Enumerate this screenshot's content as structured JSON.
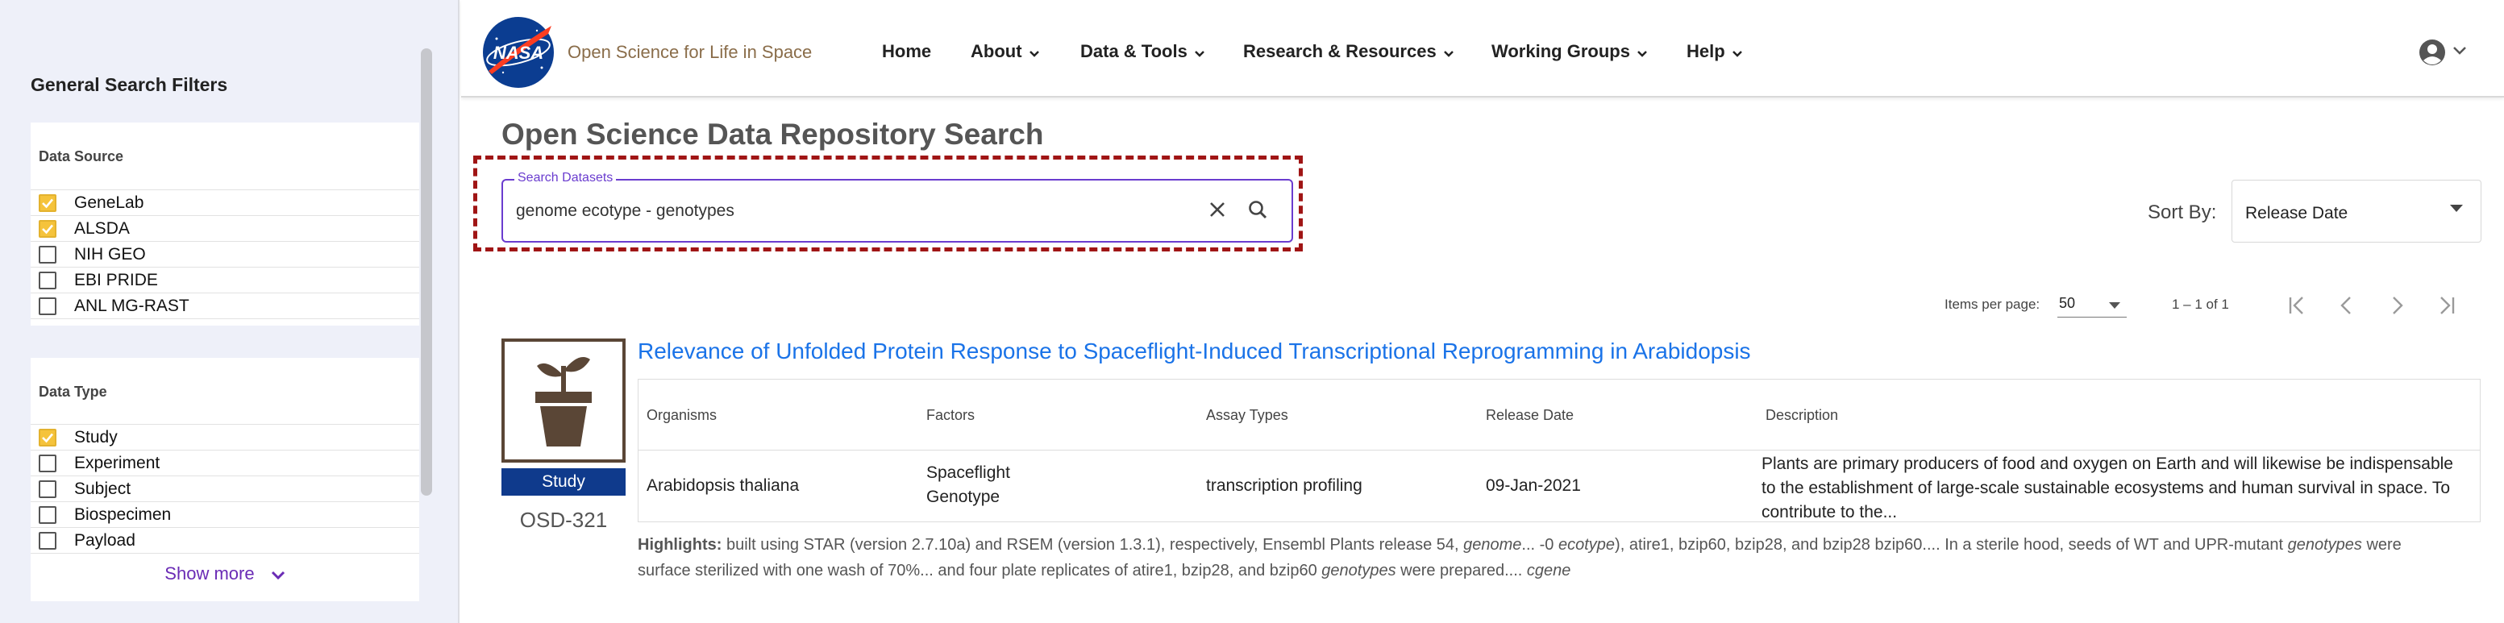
{
  "sidebar": {
    "title": "General Search Filters",
    "data_source": {
      "title": "Data Source",
      "items": [
        {
          "label": "GeneLab",
          "checked": true
        },
        {
          "label": "ALSDA",
          "checked": true
        },
        {
          "label": "NIH GEO",
          "checked": false
        },
        {
          "label": "EBI PRIDE",
          "checked": false
        },
        {
          "label": "ANL MG-RAST",
          "checked": false
        }
      ]
    },
    "data_type": {
      "title": "Data Type",
      "items": [
        {
          "label": "Study",
          "checked": true
        },
        {
          "label": "Experiment",
          "checked": false
        },
        {
          "label": "Subject",
          "checked": false
        },
        {
          "label": "Biospecimen",
          "checked": false
        },
        {
          "label": "Payload",
          "checked": false
        }
      ],
      "show_more": "Show more"
    }
  },
  "header": {
    "logo_text": "NASA",
    "site_name": "Open Science for Life in Space",
    "nav": [
      "Home",
      "About",
      "Data & Tools",
      "Research & Resources",
      "Working Groups",
      "Help"
    ]
  },
  "main": {
    "title": "Open Science Data Repository Search",
    "search": {
      "label": "Search Datasets",
      "value": "genome ecotype - genotypes"
    },
    "sort": {
      "label": "Sort By:",
      "value": "Release Date"
    },
    "pagination": {
      "items_per_page_label": "Items per page:",
      "items_per_page": "50",
      "range": "1 – 1 of 1"
    }
  },
  "result": {
    "badge": "Study",
    "id": "OSD-321",
    "title": "Relevance of Unfolded Protein Response to Spaceflight-Induced Transcriptional Reprogramming in Arabidopsis",
    "headers": [
      "Organisms",
      "Factors",
      "Assay Types",
      "Release Date",
      "Description"
    ],
    "organism": "Arabidopsis thaliana",
    "factors": [
      "Spaceflight",
      "Genotype"
    ],
    "assay": "transcription profiling",
    "release_date": "09-Jan-2021",
    "description": "Plants are primary producers of food and oxygen on Earth and will likewise be indispensable to the establishment of large-scale sustainable ecosystems and human survival in space. To contribute to the...",
    "highlights_label": "Highlights:",
    "highlights": [
      " built using STAR (version 2.7.10a) and RSEM (version 1.3.1), respectively, Ensembl Plants release 54, ",
      "genome",
      "... -0 ",
      "ecotype",
      "), atire1, bzip60, bzip28, and bzip28 bzip60.... In a sterile hood, seeds of WT and UPR-mutant ",
      "genotypes",
      " were surface sterilized with one wash of 70%... and four plate replicates of atire1, bzip28, and bzip60 ",
      "genotypes",
      " were prepared.... ",
      "cgene"
    ]
  },
  "colors": {
    "accent": "#6a3ccf",
    "link": "#1a73e8",
    "badge": "#0f3a8c",
    "checkbox": "#f5c33b",
    "annotation": "#a01515"
  }
}
